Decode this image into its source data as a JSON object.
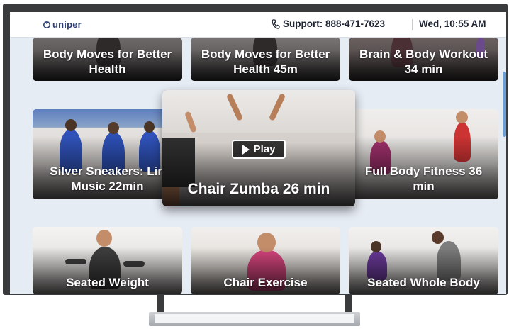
{
  "header": {
    "brand": "uniper",
    "logo_icon": "uniper-logo-icon",
    "phone_icon": "phone-icon",
    "support": "Support: 888-471-7623",
    "datetime": "Wed, 10:55 AM"
  },
  "videos": {
    "row1": [
      {
        "title": "Body Moves for Better Health"
      },
      {
        "title": "Body Moves for Better Health 45m"
      },
      {
        "title": "Brain & Body Workout 34 min"
      }
    ],
    "row2": [
      {
        "title": "Silver Sneakers: Lin Music 22min"
      },
      {
        "title": "Full Body Fitness 36 min"
      }
    ],
    "featured": {
      "title": "Chair Zumba 26 min",
      "play_label": "Play",
      "play_icon": "play-icon"
    },
    "row3": [
      {
        "title": "Seated Weight"
      },
      {
        "title": "Chair Exercise"
      },
      {
        "title": "Seated Whole Body"
      }
    ]
  },
  "colors": {
    "screen_bg": "#e6ecf4",
    "brand": "#2b3f77",
    "scroll_accent": "#6aa0d8"
  }
}
